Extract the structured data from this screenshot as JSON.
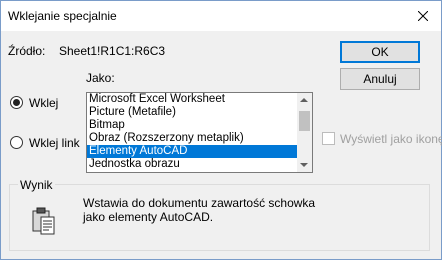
{
  "window": {
    "title": "Wklejanie specjalnie",
    "close_icon": "close-icon"
  },
  "source": {
    "label": "Źródło:",
    "value": "Sheet1!R1C1:R6C3"
  },
  "as_label": "Jako:",
  "paste_options": {
    "paste_label": "Wklej",
    "paste_link_label": "Wklej link",
    "selected": "paste"
  },
  "formats": {
    "items": [
      "Microsoft Excel Worksheet",
      "Picture (Metafile)",
      "Bitmap",
      "Obraz (Rozszerzony metaplik)",
      "Elementy AutoCAD",
      "Jednostka obrazu"
    ],
    "selected_index": 4
  },
  "display_as_icon": {
    "label": "Wyświetl jako ikonę",
    "checked": false,
    "enabled": false
  },
  "buttons": {
    "ok": "OK",
    "cancel": "Anuluj"
  },
  "result": {
    "label": "Wynik",
    "text": "Wstawia do dokumentu zawartość schowka jako elementy AutoCAD.",
    "icon": "clipboard-icon"
  }
}
